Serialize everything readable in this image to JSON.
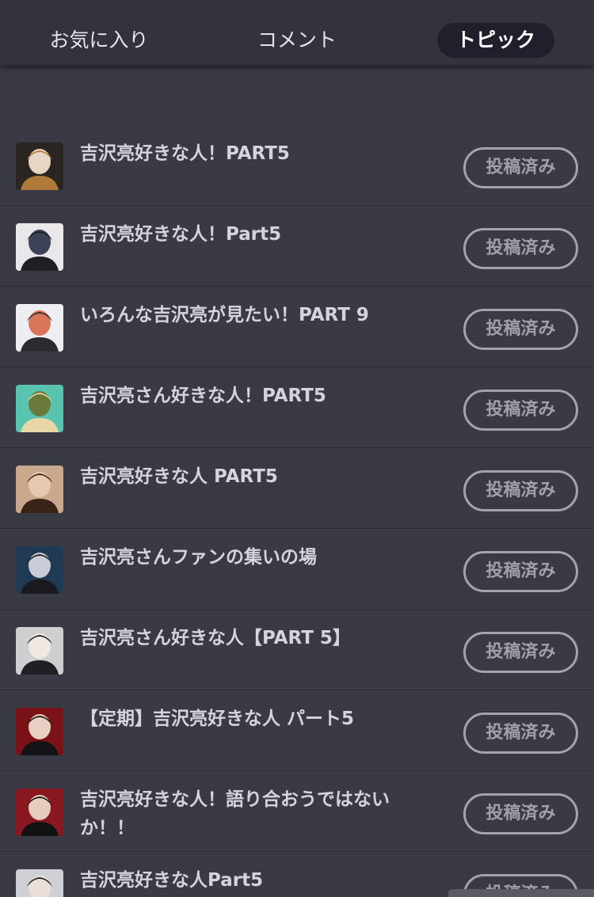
{
  "tabs": {
    "favorites": "お気に入り",
    "comments": "コメント",
    "topics": "トピック"
  },
  "topics": [
    {
      "title": "吉沢亮好きな人！PART5",
      "status": "投稿済み",
      "thumb": {
        "bg": "#d8c6b8",
        "fg": "#3a2a22",
        "accent": "#f3e4dc"
      }
    },
    {
      "title": "吉沢亮好きな人！PART5",
      "status": "投稿済み",
      "thumb": {
        "bg": "#2a2520",
        "fg": "#b07a3a",
        "accent": "#e8d6c4"
      }
    },
    {
      "title": "吉沢亮好きな人！Part5",
      "status": "投稿済み",
      "thumb": {
        "bg": "#e9e7ea",
        "fg": "#1e1e24",
        "accent": "#3c4258"
      }
    },
    {
      "title": "いろんな吉沢亮が見たい！PART 9",
      "status": "投稿済み",
      "thumb": {
        "bg": "#eeedf2",
        "fg": "#2a2a30",
        "accent": "#d9765a"
      }
    },
    {
      "title": "吉沢亮さん好きな人！PART5",
      "status": "投稿済み",
      "thumb": {
        "bg": "#58c4b0",
        "fg": "#e8d6a8",
        "accent": "#6a7a3a"
      }
    },
    {
      "title": "吉沢亮好きな人 PART5",
      "status": "投稿済み",
      "thumb": {
        "bg": "#c9a88e",
        "fg": "#3a2418",
        "accent": "#e6c8b0"
      }
    },
    {
      "title": "吉沢亮さんファンの集いの場",
      "status": "投稿済み",
      "thumb": {
        "bg": "#1f3a52",
        "fg": "#1a1a1e",
        "accent": "#c8ccd6"
      }
    },
    {
      "title": "吉沢亮さん好きな人【PART 5】",
      "status": "投稿済み",
      "thumb": {
        "bg": "#cfcfd2",
        "fg": "#202024",
        "accent": "#f0e8e2"
      }
    },
    {
      "title": "【定期】吉沢亮好きな人 パート5",
      "status": "投稿済み",
      "thumb": {
        "bg": "#7a1218",
        "fg": "#141416",
        "accent": "#e8cfc2"
      }
    },
    {
      "title": "吉沢亮好きな人！語り合おうではないか！！",
      "status": "投稿済み",
      "thumb": {
        "bg": "#8a1820",
        "fg": "#121214",
        "accent": "#e6ccbe"
      }
    },
    {
      "title": "吉沢亮好きな人Part5",
      "status": "投稿済み",
      "thumb": {
        "bg": "#cfd0d6",
        "fg": "#1e1e24",
        "accent": "#eadfd8"
      }
    }
  ]
}
